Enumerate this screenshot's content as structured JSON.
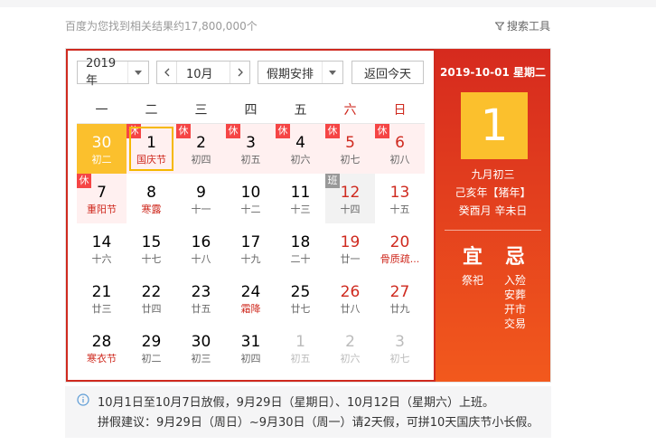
{
  "top": {
    "result_count": "百度为您找到相关结果约17,800,000个",
    "search_tools": "搜索工具"
  },
  "controls": {
    "year": "2019年",
    "month": "10月",
    "holiday_select": "假期安排",
    "today_button": "返回今天"
  },
  "weekdays": [
    "一",
    "二",
    "三",
    "四",
    "五",
    "六",
    "日"
  ],
  "calendar": {
    "rows": [
      [
        {
          "day": "30",
          "lunar": "初二",
          "other": true,
          "today": true
        },
        {
          "day": "1",
          "lunar": "国庆节",
          "badge": "休",
          "festival": true,
          "selected": true
        },
        {
          "day": "2",
          "lunar": "初四",
          "badge": "休"
        },
        {
          "day": "3",
          "lunar": "初五",
          "badge": "休"
        },
        {
          "day": "4",
          "lunar": "初六",
          "badge": "休"
        },
        {
          "day": "5",
          "lunar": "初七",
          "badge": "休",
          "weekend": true
        },
        {
          "day": "6",
          "lunar": "初八",
          "badge": "休",
          "weekend": true
        }
      ],
      [
        {
          "day": "7",
          "lunar": "重阳节",
          "badge": "休",
          "festival": true
        },
        {
          "day": "8",
          "lunar": "寒露",
          "festival": true
        },
        {
          "day": "9",
          "lunar": "十一"
        },
        {
          "day": "10",
          "lunar": "十二"
        },
        {
          "day": "11",
          "lunar": "十三"
        },
        {
          "day": "12",
          "lunar": "十四",
          "badge": "班",
          "weekend": true,
          "workday": true
        },
        {
          "day": "13",
          "lunar": "十五",
          "weekend": true
        }
      ],
      [
        {
          "day": "14",
          "lunar": "十六"
        },
        {
          "day": "15",
          "lunar": "十七"
        },
        {
          "day": "16",
          "lunar": "十八"
        },
        {
          "day": "17",
          "lunar": "十九"
        },
        {
          "day": "18",
          "lunar": "二十"
        },
        {
          "day": "19",
          "lunar": "廿一",
          "weekend": true
        },
        {
          "day": "20",
          "lunar": "骨质疏...",
          "weekend": true,
          "festival": true
        }
      ],
      [
        {
          "day": "21",
          "lunar": "廿三"
        },
        {
          "day": "22",
          "lunar": "廿四"
        },
        {
          "day": "23",
          "lunar": "廿五"
        },
        {
          "day": "24",
          "lunar": "霜降",
          "festival": true
        },
        {
          "day": "25",
          "lunar": "廿七"
        },
        {
          "day": "26",
          "lunar": "廿八",
          "weekend": true
        },
        {
          "day": "27",
          "lunar": "廿九",
          "weekend": true
        }
      ],
      [
        {
          "day": "28",
          "lunar": "寒衣节",
          "festival": true
        },
        {
          "day": "29",
          "lunar": "初二"
        },
        {
          "day": "30",
          "lunar": "初三"
        },
        {
          "day": "31",
          "lunar": "初四"
        },
        {
          "day": "1",
          "lunar": "初五",
          "other": true
        },
        {
          "day": "2",
          "lunar": "初六",
          "other": true
        },
        {
          "day": "3",
          "lunar": "初七",
          "other": true
        }
      ]
    ]
  },
  "detail": {
    "date": "2019-10-01 星期二",
    "day": "1",
    "lunar_date": "九月初三",
    "ganzhi_year": "己亥年【猪年】",
    "ganzhi_month_day": "癸酉月 辛未日",
    "yi_label": "宜",
    "ji_label": "忌",
    "yi": [
      "祭祀"
    ],
    "ji": [
      "入殓",
      "安葬",
      "开市",
      "交易"
    ]
  },
  "notice": {
    "line1": "10月1日至10月7日放假，9月29日（星期日）、10月12日（星期六）上班。",
    "line2": "拼假建议：9月29日（周日）~9月30日（周一）请2天假，可拼10天国庆节小长假。"
  },
  "colors": {
    "accent_red": "#cf2a1f",
    "today_yellow": "#fbc02d",
    "holiday_badge": "#f54545",
    "workday_badge": "#999999"
  }
}
